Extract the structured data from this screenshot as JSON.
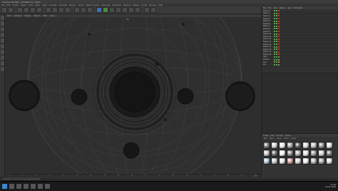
{
  "app": {
    "title": "Cinema 4D R18 - [Untitled 1] - Main"
  },
  "menu": [
    "File",
    "Edit",
    "Create",
    "Select",
    "Tools",
    "Mesh",
    "Snap",
    "Animate",
    "Simulate",
    "Render",
    "Sculpt",
    "Motion Tracker",
    "MoGraph",
    "Character",
    "Pipeline",
    "Plugins",
    "Script",
    "Window",
    "Help"
  ],
  "viewport": {
    "menu": [
      "View",
      "Cameras",
      "Display",
      "Options",
      "Filter",
      "Panel"
    ],
    "label": "Top"
  },
  "timeline": {
    "ticks": [
      "0",
      "5",
      "10",
      "15",
      "20",
      "25",
      "30",
      "35",
      "40",
      "45",
      "50",
      "55",
      "60",
      "65",
      "70",
      "75",
      "80",
      "85",
      "90"
    ],
    "current_frame": "0 F",
    "start": "0 F",
    "end": "90 F"
  },
  "objects": {
    "tabs": [
      "File",
      "Edit",
      "View",
      "Objects",
      "Tags",
      "Bookmarks"
    ],
    "rows": [
      {
        "name": "Sphere.1",
        "flag": "r"
      },
      {
        "name": "Sphere.2",
        "flag": "r"
      },
      {
        "name": "Sphere.3",
        "flag": "r"
      },
      {
        "name": "Sphere.4",
        "flag": "r"
      },
      {
        "name": "Sphere.5",
        "flag": "r"
      },
      {
        "name": "Sphere.6",
        "flag": "r"
      },
      {
        "name": "Sphere.7",
        "flag": "r"
      },
      {
        "name": "Sphere.8",
        "flag": "r"
      },
      {
        "name": "Sphere.9",
        "flag": "r"
      },
      {
        "name": "Sphere.10",
        "flag": "r"
      },
      {
        "name": "Sphere.11",
        "flag": "r"
      },
      {
        "name": "Sphere.12",
        "flag": "r"
      },
      {
        "name": "Sphere.13",
        "flag": "r"
      },
      {
        "name": "Sphere.14",
        "flag": "r"
      },
      {
        "name": "Sphere.15",
        "flag": "r"
      },
      {
        "name": "Sphere.16",
        "flag": "r"
      },
      {
        "name": "Sphere.17",
        "flag": "r"
      },
      {
        "name": "Sphere.18",
        "flag": "r"
      },
      {
        "name": "Light",
        "flag": "g"
      },
      {
        "name": "Camera",
        "flag": "w"
      },
      {
        "name": "Floor",
        "flag": "o"
      },
      {
        "name": "Sky",
        "flag": "w"
      }
    ]
  },
  "materials": {
    "tabs": [
      "Create",
      "Edit",
      "Function",
      "Texture"
    ],
    "sub": [
      "Mat",
      "Mat.1",
      "Mat.2",
      "Mat.3",
      "Mat.4"
    ],
    "colors": [
      "#7a7a7a",
      "#cfcfcf",
      "#e8e8e8",
      "#a0a0a0",
      "#5b5b5b",
      "#d8d8d8",
      "#bdbdbd",
      "#909090",
      "#e0e0e0",
      "#c4c4c4",
      "#6e6e6e",
      "#f0f0f0",
      "#8a8a8a",
      "#b0b0b0",
      "#e6e6e6",
      "#9c9c9c",
      "#d0d0d0",
      "#7c7c7c",
      "#a8c6d8",
      "#c7c7c7",
      "#e2e2e2",
      "#cc9b9b",
      "#d6d6d6",
      "#ececec",
      "#b8b8b8",
      "#a4a4a4",
      "#dadada"
    ]
  },
  "status": "Live Selection: Click and drag to select elements.",
  "tray": {
    "time": "11:30",
    "date": "21.01.2019"
  }
}
